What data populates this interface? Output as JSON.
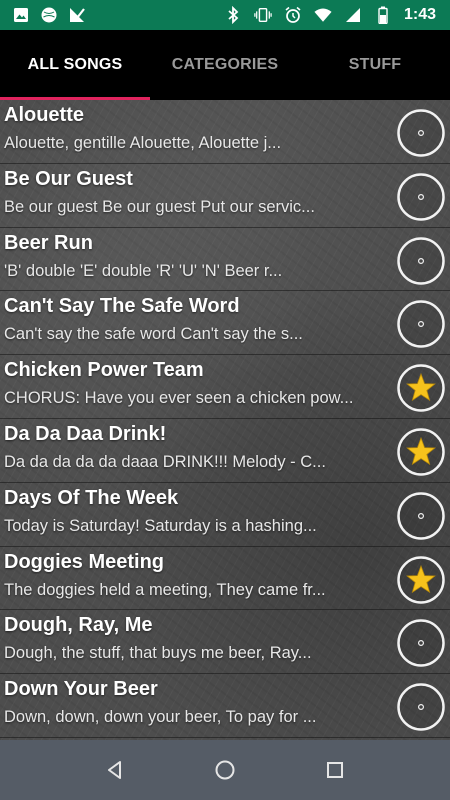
{
  "status_bar": {
    "time": "1:43",
    "background": "#0c7a55",
    "left_icons": [
      "image-icon",
      "globe-icon",
      "app-check-icon"
    ],
    "right_icons": [
      "bluetooth-icon",
      "vibrate-icon",
      "alarm-icon",
      "wifi-icon",
      "cell-signal-icon",
      "battery-icon"
    ]
  },
  "tabs": [
    {
      "label": "ALL SONGS",
      "active": true
    },
    {
      "label": "CATEGORIES",
      "active": false
    },
    {
      "label": "STUFF",
      "active": false
    }
  ],
  "accent_color": "#e0245e",
  "songs": [
    {
      "title": "Alouette",
      "preview": "Alouette, gentille Alouette,  Alouette j...",
      "favorite": false
    },
    {
      "title": "Be Our Guest",
      "preview": "Be our guest Be our guest Put our servic...",
      "favorite": false
    },
    {
      "title": "Beer Run",
      "preview": "'B' double 'E' double 'R' 'U' 'N' Beer r...",
      "favorite": false
    },
    {
      "title": "Can't Say The Safe Word",
      "preview": "Can't say the safe word  Can't say the s...",
      "favorite": false
    },
    {
      "title": "Chicken Power Team",
      "preview": "CHORUS: Have you ever seen a chicken pow...",
      "favorite": true
    },
    {
      "title": "Da Da Daa Drink!",
      "preview": "Da da da da da daaa DRINK!!!  Melody - C...",
      "favorite": true
    },
    {
      "title": "Days Of The Week",
      "preview": "Today is Saturday! Saturday is a hashing...",
      "favorite": false
    },
    {
      "title": "Doggies Meeting",
      "preview": "The doggies held a meeting, They came fr...",
      "favorite": true
    },
    {
      "title": "Dough, Ray, Me",
      "preview": "Dough, the stuff, that buys me beer, Ray...",
      "favorite": false
    },
    {
      "title": "Down Your Beer",
      "preview": "Down, down, down your beer,  To pay for ...",
      "favorite": false
    }
  ],
  "nav_bar": {
    "buttons": [
      "back-icon",
      "home-icon",
      "recents-icon"
    ]
  }
}
